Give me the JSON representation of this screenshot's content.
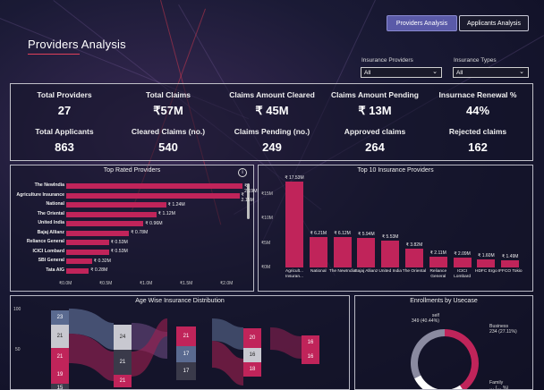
{
  "nav": {
    "providers_label": "Providers Analysis",
    "applicants_label": "Applicants Analysis"
  },
  "page_title": "Providers Analysis",
  "filters": {
    "providers": {
      "label": "Insurance Providers",
      "value": "All"
    },
    "types": {
      "label": "Insurance Types",
      "value": "All"
    }
  },
  "kpis": [
    {
      "label": "Total Providers",
      "value": "27"
    },
    {
      "label": "Total Claims",
      "value": "₹57M"
    },
    {
      "label": "Claims Amount Cleared",
      "value": "₹ 45M"
    },
    {
      "label": "Claims Amount Pending",
      "value": "₹ 13M"
    },
    {
      "label": "Insurnace Renewal %",
      "value": "44%"
    },
    {
      "label": "Total Applicants",
      "value": "863"
    },
    {
      "label": "Cleared Claims (no.)",
      "value": "540"
    },
    {
      "label": "Claims Pending (no.)",
      "value": "249"
    },
    {
      "label": "Approved claims",
      "value": "264"
    },
    {
      "label": "Rejected claims",
      "value": "162"
    }
  ],
  "colors": {
    "bar": "#c0245a",
    "accent": "#5a5aa8"
  },
  "top_rated": {
    "title": "Top Rated Providers",
    "info_icon": "info-icon",
    "ticks": [
      "₹0.0M",
      "₹0.5M",
      "₹1.0M",
      "₹1.5M",
      "₹2.0M"
    ],
    "xmax": 2.0
  },
  "top10": {
    "title": "Top 10 Insurance Providers",
    "yticks": [
      "₹15M",
      "₹10M",
      "₹5M",
      "₹0M"
    ],
    "ymax": 17.53
  },
  "age_dist": {
    "title": "Age Wise Insurance Distribution",
    "yticks": [
      "100",
      "50"
    ],
    "cells": [
      "23",
      "21",
      "24",
      "21",
      "21",
      "20",
      "21",
      "17",
      "16",
      "19",
      "17",
      "16",
      "21",
      "16",
      "18",
      "15"
    ]
  },
  "enrollments": {
    "title": "Enrollments by Usecase",
    "legend_self_name": "self",
    "legend_self_value": "349 (40.44%)",
    "legend_business_name": "Business",
    "legend_business_value": "234 (27.11%)",
    "legend_family_name": "Family",
    "legend_family_value": "… (… %)"
  },
  "chart_data": [
    {
      "type": "bar",
      "title": "Top Rated Providers",
      "orientation": "horizontal",
      "categories": [
        "The NewIndia",
        "Agriculture Insurance",
        "National",
        "The Oriental",
        "United India",
        "Bajaj Allianz",
        "Reliance General",
        "ICICI Lombard",
        "SBI General",
        "Tata AIG"
      ],
      "values": [
        2.19,
        2.15,
        1.24,
        1.12,
        0.96,
        0.78,
        0.53,
        0.53,
        0.32,
        0.28
      ],
      "value_labels": [
        "₹ 2.19M",
        "₹ 2.15M",
        "₹ 1.24M",
        "₹ 1.12M",
        "₹ 0.96M",
        "₹ 0.78M",
        "₹ 0.53M",
        "₹ 0.53M",
        "₹ 0.32M",
        "₹ 0.28M"
      ],
      "xlim": [
        0,
        2.0
      ]
    },
    {
      "type": "bar",
      "title": "Top 10 Insurance Providers",
      "categories": [
        "Agricult... Insuran...",
        "National",
        "The NewIndia",
        "Bajaj Allianz",
        "United India",
        "The Oriental",
        "Reliance General",
        "ICICI Lombard",
        "HDFC Ergo",
        "IFFCO Tokio"
      ],
      "values": [
        17.53,
        6.21,
        6.12,
        5.94,
        5.53,
        3.82,
        2.11,
        2.09,
        1.6,
        1.49
      ],
      "value_labels": [
        "₹ 17.53M",
        "₹ 6.21M",
        "₹ 6.12M",
        "₹ 5.94M",
        "₹ 5.53M",
        "₹ 3.82M",
        "₹ 2.11M",
        "₹ 2.09M",
        "₹ 1.60M",
        "₹ 1.49M"
      ],
      "ylim": [
        0,
        17.53
      ]
    },
    {
      "type": "pie",
      "title": "Enrollments by Usecase",
      "categories": [
        "self",
        "Business",
        "Family"
      ],
      "values": [
        349,
        234,
        280
      ]
    }
  ]
}
